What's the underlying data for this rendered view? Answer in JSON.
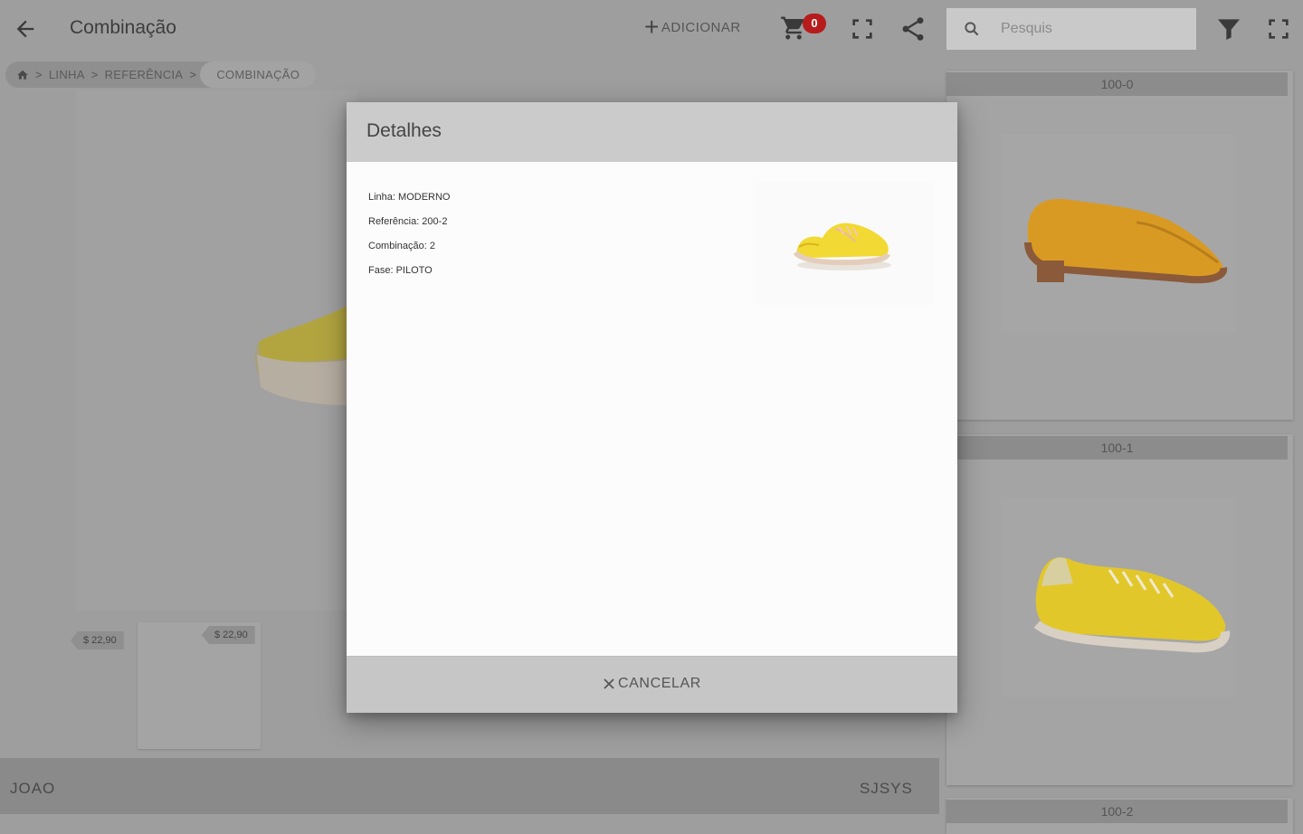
{
  "appbar": {
    "title": "Combinação",
    "add_label": "ADICIONAR",
    "cart_count": "0",
    "search_placeholder": "Pesquis"
  },
  "breadcrumb": {
    "items": [
      "LINHA",
      "REFERÊNCIA"
    ],
    "separator": ">",
    "current": "COMBINAÇÃO"
  },
  "main": {
    "prices": [
      "$ 22,90",
      "$ 22,90"
    ]
  },
  "footer": {
    "user": "JOAO",
    "brand": "SJSYS"
  },
  "right_panel": {
    "cards": [
      {
        "label": "100-0",
        "shoe_color": "#e3a126"
      },
      {
        "label": "100-1",
        "shoe_color": "#e8cf2a"
      },
      {
        "label": "100-2"
      }
    ]
  },
  "dialog": {
    "title": "Detalhes",
    "details": [
      "Linha: MODERNO",
      "Referência: 200-2",
      "Combinação: 2",
      "Fase: PILOTO"
    ],
    "cancel_label": "CANCELAR"
  },
  "colors": {
    "overlay": "#9e9e9e",
    "badge": "#b71c1c",
    "shoe_yellow": "#f2d933"
  }
}
